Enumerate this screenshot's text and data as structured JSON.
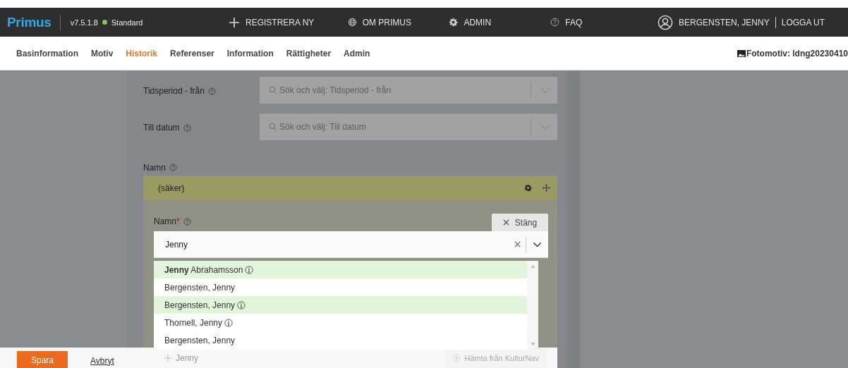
{
  "header": {
    "logo": "Primus",
    "version": "v7.5.1.8",
    "environment": "Standard",
    "nav": [
      {
        "kind": "plus",
        "label": "REGISTRERA NY"
      },
      {
        "kind": "globe",
        "label": "OM PRIMUS"
      },
      {
        "kind": "gear",
        "label": "ADMIN"
      },
      {
        "kind": "help",
        "label": "FAQ"
      }
    ],
    "user": "BERGENSTEN, JENNY",
    "logout": "LOGGA UT"
  },
  "tabs": [
    {
      "label": "Basinformation",
      "selected": false
    },
    {
      "label": "Motiv",
      "selected": false
    },
    {
      "label": "Historik",
      "selected": true
    },
    {
      "label": "Referenser",
      "selected": false
    },
    {
      "label": "Information",
      "selected": false
    },
    {
      "label": "Rättigheter",
      "selected": false
    },
    {
      "label": "Admin",
      "selected": false
    }
  ],
  "record_label": "Fotomotiv: ldng20230410",
  "form": {
    "fields": [
      {
        "label": "Tidsperiod - från",
        "placeholder": "Sök och välj: Tidsperiod - från"
      },
      {
        "label": "Till datum",
        "placeholder": "Sök och välj: Till datum"
      }
    ],
    "name_section": {
      "label": "Namn",
      "item": {
        "title": "(säker)",
        "editor": {
          "label": "Namn",
          "required_mark": "*",
          "close_button": "Stäng",
          "value": "Jenny",
          "options": [
            {
              "text": "**Jenny** Abrahamsson",
              "info": true,
              "highlighted": true
            },
            {
              "text": "Bergensten, Jenny",
              "info": false,
              "highlighted": false
            },
            {
              "text": "Bergensten, Jenny",
              "info": true,
              "highlighted": true
            },
            {
              "text": "Thornell, Jenny",
              "info": true,
              "highlighted": false
            },
            {
              "text": "Bergensten, Jenny",
              "info": false,
              "highlighted": false
            }
          ],
          "add_label": "Jenny",
          "fetch_button": "Hämta från KulturNav"
        }
      }
    }
  },
  "footer": {
    "save": "Spara",
    "cancel": "Avbryt"
  }
}
